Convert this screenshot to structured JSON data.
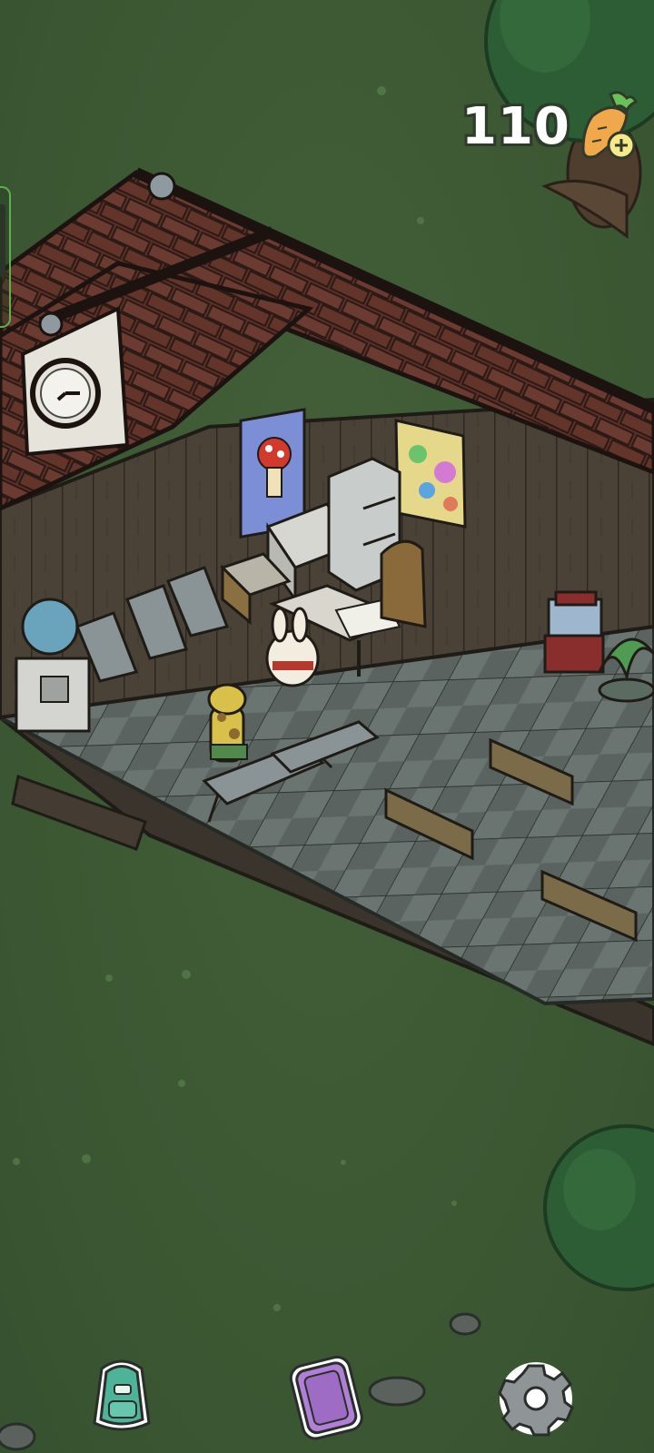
{
  "hud": {
    "carrot_count": "110",
    "currency_icon": "carrot-plus-icon"
  },
  "toolbar": {
    "items": [
      {
        "name": "backpack",
        "icon": "backpack-icon"
      },
      {
        "name": "phone",
        "icon": "phone-icon"
      },
      {
        "name": "settings",
        "icon": "gear-icon"
      }
    ]
  },
  "colors": {
    "grass": "#3d5a34",
    "roof": "#5a2f26",
    "wall": "#4a4136",
    "floor_light": "#6b7570",
    "floor_dark": "#545d59",
    "phone_accent": "#b07fd6",
    "backpack_accent": "#4fb39a"
  }
}
